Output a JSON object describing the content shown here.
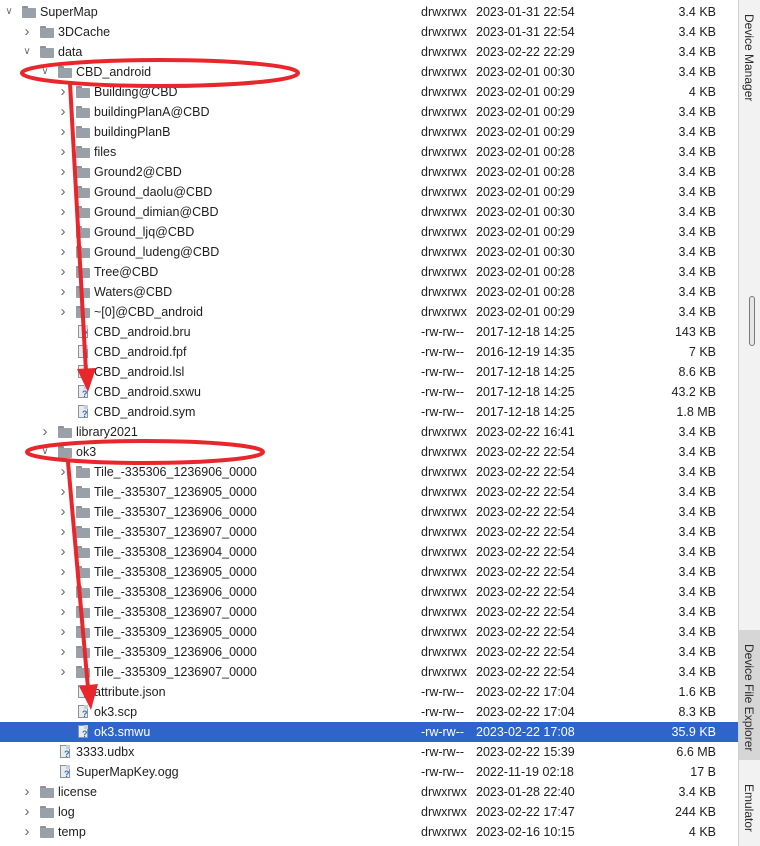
{
  "colors": {
    "selection": "#2f65ca",
    "annotation": "#e8262b",
    "folder": "#9aa0a8",
    "file_badge": "#2f6ed1"
  },
  "file_explorer": {
    "rows": [
      {
        "depth": 0,
        "expander": "expanded",
        "icon": "folder",
        "name": "SuperMap",
        "permissions": "drwxrwx",
        "date": "2023-01-31 22:54",
        "size": "3.4 KB"
      },
      {
        "depth": 1,
        "expander": "collapsed",
        "icon": "folder",
        "name": "3DCache",
        "permissions": "drwxrwx",
        "date": "2023-01-31 22:54",
        "size": "3.4 KB"
      },
      {
        "depth": 1,
        "expander": "expanded",
        "icon": "folder",
        "name": "data",
        "permissions": "drwxrwx",
        "date": "2023-02-22 22:29",
        "size": "3.4 KB"
      },
      {
        "depth": 2,
        "expander": "expanded",
        "icon": "folder",
        "name": "CBD_android",
        "permissions": "drwxrwx",
        "date": "2023-02-01 00:30",
        "size": "3.4 KB"
      },
      {
        "depth": 3,
        "expander": "collapsed",
        "icon": "folder",
        "name": "Building@CBD",
        "permissions": "drwxrwx",
        "date": "2023-02-01 00:29",
        "size": "4 KB"
      },
      {
        "depth": 3,
        "expander": "collapsed",
        "icon": "folder",
        "name": "buildingPlanA@CBD",
        "permissions": "drwxrwx",
        "date": "2023-02-01 00:29",
        "size": "3.4 KB"
      },
      {
        "depth": 3,
        "expander": "collapsed",
        "icon": "folder",
        "name": "buildingPlanB",
        "permissions": "drwxrwx",
        "date": "2023-02-01 00:29",
        "size": "3.4 KB"
      },
      {
        "depth": 3,
        "expander": "collapsed",
        "icon": "folder",
        "name": "files",
        "permissions": "drwxrwx",
        "date": "2023-02-01 00:28",
        "size": "3.4 KB"
      },
      {
        "depth": 3,
        "expander": "collapsed",
        "icon": "folder",
        "name": "Ground2@CBD",
        "permissions": "drwxrwx",
        "date": "2023-02-01 00:28",
        "size": "3.4 KB"
      },
      {
        "depth": 3,
        "expander": "collapsed",
        "icon": "folder",
        "name": "Ground_daolu@CBD",
        "permissions": "drwxrwx",
        "date": "2023-02-01 00:29",
        "size": "3.4 KB"
      },
      {
        "depth": 3,
        "expander": "collapsed",
        "icon": "folder",
        "name": "Ground_dimian@CBD",
        "permissions": "drwxrwx",
        "date": "2023-02-01 00:30",
        "size": "3.4 KB"
      },
      {
        "depth": 3,
        "expander": "collapsed",
        "icon": "folder",
        "name": "Ground_ljq@CBD",
        "permissions": "drwxrwx",
        "date": "2023-02-01 00:29",
        "size": "3.4 KB"
      },
      {
        "depth": 3,
        "expander": "collapsed",
        "icon": "folder",
        "name": "Ground_ludeng@CBD",
        "permissions": "drwxrwx",
        "date": "2023-02-01 00:30",
        "size": "3.4 KB"
      },
      {
        "depth": 3,
        "expander": "collapsed",
        "icon": "folder",
        "name": "Tree@CBD",
        "permissions": "drwxrwx",
        "date": "2023-02-01 00:28",
        "size": "3.4 KB"
      },
      {
        "depth": 3,
        "expander": "collapsed",
        "icon": "folder",
        "name": "Waters@CBD",
        "permissions": "drwxrwx",
        "date": "2023-02-01 00:28",
        "size": "3.4 KB"
      },
      {
        "depth": 3,
        "expander": "collapsed",
        "icon": "folder",
        "name": "~[0]@CBD_android",
        "permissions": "drwxrwx",
        "date": "2023-02-01 00:29",
        "size": "3.4 KB"
      },
      {
        "depth": 3,
        "expander": "none",
        "icon": "file",
        "name": "CBD_android.bru",
        "permissions": "-rw-rw--",
        "date": "2017-12-18 14:25",
        "size": "143 KB"
      },
      {
        "depth": 3,
        "expander": "none",
        "icon": "file",
        "name": "CBD_android.fpf",
        "permissions": "-rw-rw--",
        "date": "2016-12-19 14:35",
        "size": "7 KB"
      },
      {
        "depth": 3,
        "expander": "none",
        "icon": "file",
        "name": "CBD_android.lsl",
        "permissions": "-rw-rw--",
        "date": "2017-12-18 14:25",
        "size": "8.6 KB"
      },
      {
        "depth": 3,
        "expander": "none",
        "icon": "file",
        "name": "CBD_android.sxwu",
        "permissions": "-rw-rw--",
        "date": "2017-12-18 14:25",
        "size": "43.2 KB"
      },
      {
        "depth": 3,
        "expander": "none",
        "icon": "file",
        "name": "CBD_android.sym",
        "permissions": "-rw-rw--",
        "date": "2017-12-18 14:25",
        "size": "1.8 MB"
      },
      {
        "depth": 2,
        "expander": "collapsed",
        "icon": "folder",
        "name": "library2021",
        "permissions": "drwxrwx",
        "date": "2023-02-22 16:41",
        "size": "3.4 KB"
      },
      {
        "depth": 2,
        "expander": "expanded",
        "icon": "folder",
        "name": "ok3",
        "permissions": "drwxrwx",
        "date": "2023-02-22 22:54",
        "size": "3.4 KB"
      },
      {
        "depth": 3,
        "expander": "collapsed",
        "icon": "folder",
        "name": "Tile_-335306_1236906_0000",
        "permissions": "drwxrwx",
        "date": "2023-02-22 22:54",
        "size": "3.4 KB"
      },
      {
        "depth": 3,
        "expander": "collapsed",
        "icon": "folder",
        "name": "Tile_-335307_1236905_0000",
        "permissions": "drwxrwx",
        "date": "2023-02-22 22:54",
        "size": "3.4 KB"
      },
      {
        "depth": 3,
        "expander": "collapsed",
        "icon": "folder",
        "name": "Tile_-335307_1236906_0000",
        "permissions": "drwxrwx",
        "date": "2023-02-22 22:54",
        "size": "3.4 KB"
      },
      {
        "depth": 3,
        "expander": "collapsed",
        "icon": "folder",
        "name": "Tile_-335307_1236907_0000",
        "permissions": "drwxrwx",
        "date": "2023-02-22 22:54",
        "size": "3.4 KB"
      },
      {
        "depth": 3,
        "expander": "collapsed",
        "icon": "folder",
        "name": "Tile_-335308_1236904_0000",
        "permissions": "drwxrwx",
        "date": "2023-02-22 22:54",
        "size": "3.4 KB"
      },
      {
        "depth": 3,
        "expander": "collapsed",
        "icon": "folder",
        "name": "Tile_-335308_1236905_0000",
        "permissions": "drwxrwx",
        "date": "2023-02-22 22:54",
        "size": "3.4 KB"
      },
      {
        "depth": 3,
        "expander": "collapsed",
        "icon": "folder",
        "name": "Tile_-335308_1236906_0000",
        "permissions": "drwxrwx",
        "date": "2023-02-22 22:54",
        "size": "3.4 KB"
      },
      {
        "depth": 3,
        "expander": "collapsed",
        "icon": "folder",
        "name": "Tile_-335308_1236907_0000",
        "permissions": "drwxrwx",
        "date": "2023-02-22 22:54",
        "size": "3.4 KB"
      },
      {
        "depth": 3,
        "expander": "collapsed",
        "icon": "folder",
        "name": "Tile_-335309_1236905_0000",
        "permissions": "drwxrwx",
        "date": "2023-02-22 22:54",
        "size": "3.4 KB"
      },
      {
        "depth": 3,
        "expander": "collapsed",
        "icon": "folder",
        "name": "Tile_-335309_1236906_0000",
        "permissions": "drwxrwx",
        "date": "2023-02-22 22:54",
        "size": "3.4 KB"
      },
      {
        "depth": 3,
        "expander": "collapsed",
        "icon": "folder",
        "name": "Tile_-335309_1236907_0000",
        "permissions": "drwxrwx",
        "date": "2023-02-22 22:54",
        "size": "3.4 KB"
      },
      {
        "depth": 3,
        "expander": "none",
        "icon": "file",
        "name": "attribute.json",
        "permissions": "-rw-rw--",
        "date": "2023-02-22 17:04",
        "size": "1.6 KB"
      },
      {
        "depth": 3,
        "expander": "none",
        "icon": "file",
        "name": "ok3.scp",
        "permissions": "-rw-rw--",
        "date": "2023-02-22 17:04",
        "size": "8.3 KB"
      },
      {
        "depth": 3,
        "expander": "none",
        "icon": "file",
        "name": "ok3.smwu",
        "permissions": "-rw-rw--",
        "date": "2023-02-22 17:08",
        "size": "35.9 KB",
        "selected": true
      },
      {
        "depth": 2,
        "expander": "none",
        "icon": "file",
        "name": "3333.udbx",
        "permissions": "-rw-rw--",
        "date": "2023-02-22 15:39",
        "size": "6.6 MB"
      },
      {
        "depth": 2,
        "expander": "none",
        "icon": "file",
        "name": "SuperMapKey.ogg",
        "permissions": "-rw-rw--",
        "date": "2022-11-19 02:18",
        "size": "17 B"
      },
      {
        "depth": 1,
        "expander": "collapsed",
        "icon": "folder",
        "name": "license",
        "permissions": "drwxrwx",
        "date": "2023-01-28 22:40",
        "size": "3.4 KB"
      },
      {
        "depth": 1,
        "expander": "collapsed",
        "icon": "folder",
        "name": "log",
        "permissions": "drwxrwx",
        "date": "2023-02-22 17:47",
        "size": "244 KB"
      },
      {
        "depth": 1,
        "expander": "collapsed",
        "icon": "folder",
        "name": "temp",
        "permissions": "drwxrwx",
        "date": "2023-02-16 10:15",
        "size": "4 KB"
      }
    ]
  },
  "sidebar": {
    "tabs": [
      {
        "label": "Device Manager",
        "active": false
      },
      {
        "label": "Device File Explorer",
        "active": true
      },
      {
        "label": "Emulator",
        "active": false
      }
    ]
  }
}
